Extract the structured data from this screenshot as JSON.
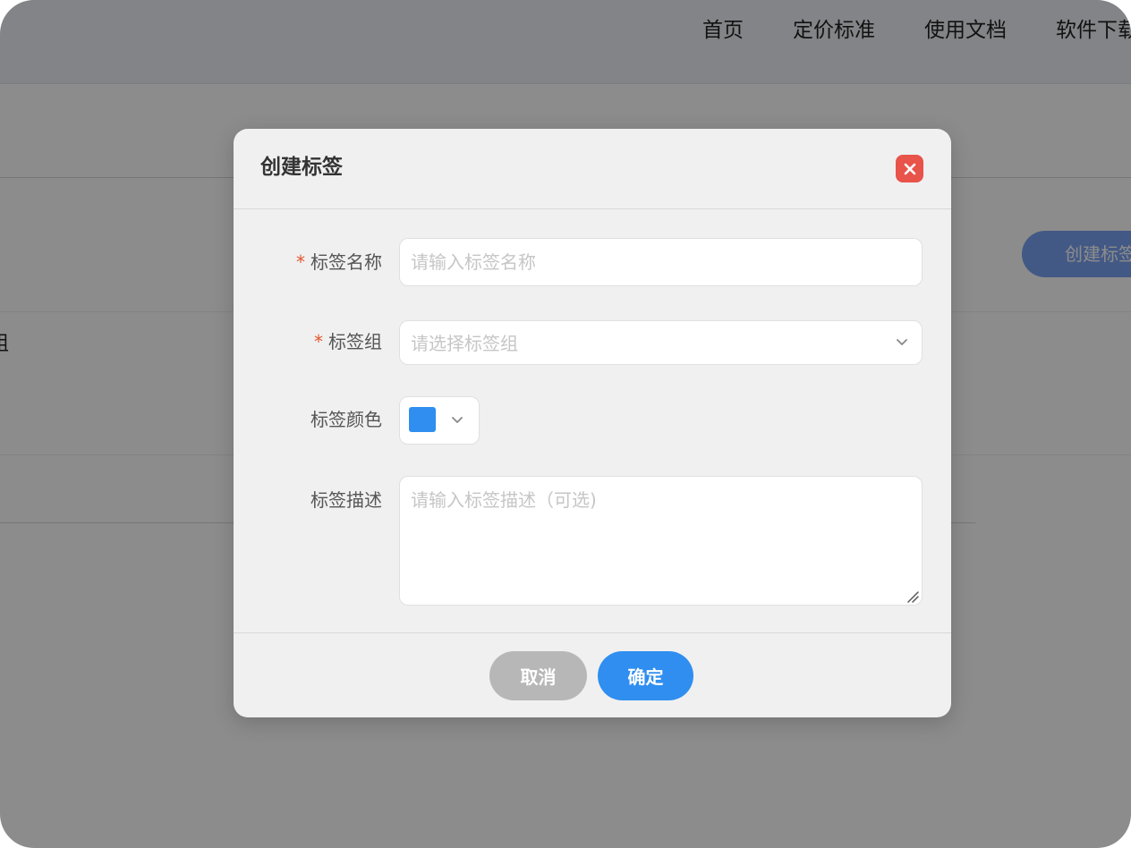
{
  "nav": {
    "items": [
      "首页",
      "定价标准",
      "使用文档",
      "软件下载"
    ]
  },
  "background": {
    "create_button_label": "创建标签",
    "side_text": "组"
  },
  "dialog": {
    "title": "创建标签",
    "close_icon": "close-icon",
    "fields": {
      "name": {
        "label": "标签名称",
        "required_mark": "*",
        "placeholder": "请输入标签名称",
        "value": ""
      },
      "group": {
        "label": "标签组",
        "required_mark": "*",
        "placeholder": "请选择标签组",
        "selected": ""
      },
      "color": {
        "label": "标签颜色",
        "value": "#2f8ef0"
      },
      "description": {
        "label": "标签描述",
        "placeholder": "请输入标签描述（可选)",
        "value": ""
      }
    },
    "buttons": {
      "cancel": "取消",
      "confirm": "确定"
    }
  },
  "colors": {
    "primary": "#2f8ef0",
    "danger": "#e8534a",
    "cancel": "#b7b7b7"
  }
}
